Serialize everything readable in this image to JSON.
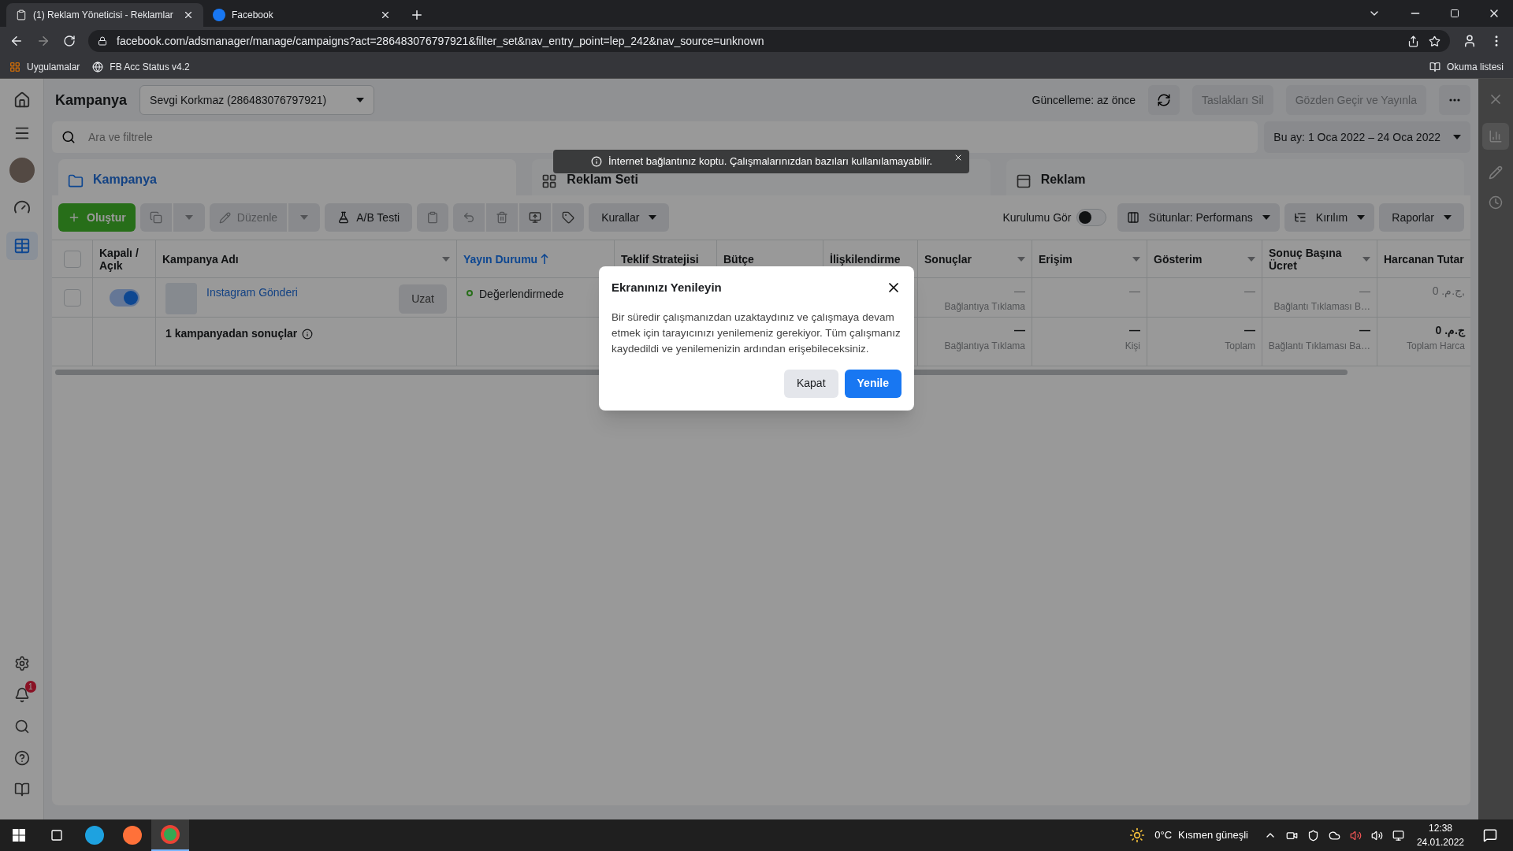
{
  "browser": {
    "tabs": [
      {
        "title": "(1) Reklam Yöneticisi - Reklamlar",
        "selected": true
      },
      {
        "title": "Facebook",
        "selected": false
      }
    ],
    "url": "facebook.com/adsmanager/manage/campaigns?act=286483076797921&filter_set&nav_entry_point=lep_242&nav_source=unknown",
    "bookmarks": [
      "Uygulamalar",
      "FB Acc Status v4.2"
    ],
    "reading_list": "Okuma listesi"
  },
  "sidebar": {
    "notification_count": "1"
  },
  "header": {
    "title": "Kampanya",
    "account": "Sevgi Korkmaz (286483076797921)",
    "updated": "Güncelleme: az önce",
    "buttons": [
      "Taslakları Sil",
      "Gözden Geçir ve Yayınla"
    ]
  },
  "search": {
    "placeholder": "Ara ve filtrele"
  },
  "date_range": "Bu ay: 1 Oca 2022 – 24 Oca 2022",
  "toast": "İnternet bağlantınız koptu. Çalışmalarınızdan bazıları kullanılamayabilir.",
  "level_tabs": [
    {
      "label": "Kampanya",
      "selected": true
    },
    {
      "label": "Reklam Seti",
      "selected": false
    },
    {
      "label": "Reklam",
      "selected": false
    }
  ],
  "toolbar": {
    "create": "Oluştur",
    "edit": "Düzenle",
    "ab_test": "A/B Testi",
    "rules": "Kurallar",
    "setup_label": "Kurulumu Gör",
    "setup_on": false,
    "columns": "Sütunlar: Performans",
    "breakdown": "Kırılım",
    "reports": "Raporlar"
  },
  "table": {
    "columns": [
      {
        "kind": "checkbox",
        "checked": false
      },
      {
        "kind": "label",
        "label": "Kapalı / Açık",
        "sorted": false,
        "menu": false
      },
      {
        "kind": "label",
        "label": "Kampanya Adı",
        "sorted": false,
        "menu": true
      },
      {
        "kind": "label",
        "label": "Yayın Durumu",
        "sorted": true,
        "menu": false
      },
      {
        "kind": "label",
        "label": "Teklif Stratejisi",
        "sorted": false,
        "menu": false
      },
      {
        "kind": "label",
        "label": "Bütçe",
        "sorted": false,
        "menu": false
      },
      {
        "kind": "label",
        "label": "İlişkilendirme",
        "sorted": false,
        "menu": false
      },
      {
        "kind": "label",
        "label": "Sonuçlar",
        "sorted": false,
        "menu": true
      },
      {
        "kind": "label",
        "label": "Erişim",
        "sorted": false,
        "menu": true
      },
      {
        "kind": "label",
        "label": "Gösterim",
        "sorted": false,
        "menu": true
      },
      {
        "kind": "label",
        "label": "Sonuç Başına Ücret",
        "sorted": false,
        "menu": true
      },
      {
        "kind": "label",
        "label": "Harcanan Tutar",
        "sorted": false,
        "menu": false
      }
    ],
    "rows": [
      [
        {
          "kind": "checkbox",
          "checked": false
        },
        {
          "kind": "toggle",
          "on": true
        },
        {
          "kind": "campaign",
          "name": "Instagram Gönderi",
          "action": "Uzat"
        },
        {
          "kind": "status",
          "text": "Değerlendirmede"
        },
        {
          "kind": "blank"
        },
        {
          "kind": "blank"
        },
        {
          "kind": "blank"
        },
        {
          "kind": "metric",
          "value": "—",
          "note": "Bağlantıya Tıklama"
        },
        {
          "kind": "metric",
          "value": "—"
        },
        {
          "kind": "metric",
          "value": "—"
        },
        {
          "kind": "metric",
          "value": "—",
          "note": "Bağlantı Tıklaması B…"
        },
        {
          "kind": "metric",
          "value": "ج.م. 0,"
        }
      ],
      [
        {
          "kind": "blank"
        },
        {
          "kind": "blank"
        },
        {
          "kind": "summary",
          "text": "1 kampanyadan sonuçlar"
        },
        {
          "kind": "blank"
        },
        {
          "kind": "blank"
        },
        {
          "kind": "blank"
        },
        {
          "kind": "blank"
        },
        {
          "kind": "total",
          "value": "—",
          "note": "Bağlantıya Tıklama"
        },
        {
          "kind": "total",
          "value": "—",
          "note": "Kişi"
        },
        {
          "kind": "total",
          "value": "—",
          "note": "Toplam"
        },
        {
          "kind": "total",
          "value": "—",
          "note": "Bağlantı Tıklaması Ba…"
        },
        {
          "kind": "total",
          "value": "ج.م. 0",
          "note": "Toplam Harca"
        }
      ]
    ]
  },
  "dialog": {
    "title": "Ekranınızı Yenileyin",
    "body": "Bir süredir çalışmanızdan uzaktaydınız ve çalışmaya devam etmek için tarayıcınızı yenilemeniz gerekiyor. Tüm çalışmanız kaydedildi ve yenilemenizin ardından erişebileceksiniz.",
    "buttons": [
      "Kapat",
      "Yenile"
    ]
  },
  "taskbar": {
    "temperature": "0°C",
    "weather": "Kısmen güneşli",
    "time": "12:38",
    "date": "24.01.2022"
  }
}
